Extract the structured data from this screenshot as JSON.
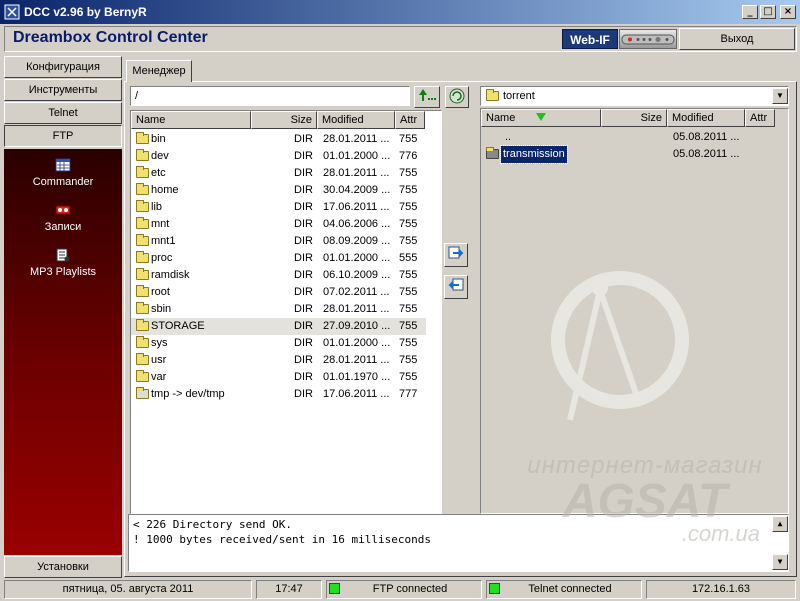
{
  "window": {
    "title": "DCC v2.96 by BernyR",
    "buttons": {
      "minimize": "_",
      "maximize": "□",
      "close": "×"
    }
  },
  "header": {
    "app_title": "Dreambox Control Center",
    "webif_label": "Web-IF",
    "exit_label": "Выход"
  },
  "sidebar": {
    "buttons": [
      "Конфигурация",
      "Инструменты",
      "Telnet",
      "FTP"
    ],
    "active": "FTP",
    "panel_items": [
      {
        "label": "Commander",
        "icon": "commander-icon"
      },
      {
        "label": "Записи",
        "icon": "recordings-icon"
      },
      {
        "label": "MP3 Playlists",
        "icon": "playlist-icon"
      }
    ],
    "settings_label": "Установки"
  },
  "tab": {
    "label": "Менеджер"
  },
  "left_panel": {
    "path": "/",
    "columns": [
      "Name",
      "Size",
      "Modified",
      "Attr"
    ],
    "rows": [
      {
        "name": "bin",
        "size": "DIR",
        "modified": "28.01.2011 ...",
        "attr": "755"
      },
      {
        "name": "dev",
        "size": "DIR",
        "modified": "01.01.2000 ...",
        "attr": "776"
      },
      {
        "name": "etc",
        "size": "DIR",
        "modified": "28.01.2011 ...",
        "attr": "755"
      },
      {
        "name": "home",
        "size": "DIR",
        "modified": "30.04.2009 ...",
        "attr": "755"
      },
      {
        "name": "lib",
        "size": "DIR",
        "modified": "17.06.2011 ...",
        "attr": "755"
      },
      {
        "name": "mnt",
        "size": "DIR",
        "modified": "04.06.2006 ...",
        "attr": "755"
      },
      {
        "name": "mnt1",
        "size": "DIR",
        "modified": "08.09.2009 ...",
        "attr": "755"
      },
      {
        "name": "proc",
        "size": "DIR",
        "modified": "01.01.2000 ...",
        "attr": "555"
      },
      {
        "name": "ramdisk",
        "size": "DIR",
        "modified": "06.10.2009 ...",
        "attr": "755"
      },
      {
        "name": "root",
        "size": "DIR",
        "modified": "07.02.2011 ...",
        "attr": "755"
      },
      {
        "name": "sbin",
        "size": "DIR",
        "modified": "28.01.2011 ...",
        "attr": "755"
      },
      {
        "name": "STORAGE",
        "size": "DIR",
        "modified": "27.09.2010 ...",
        "attr": "755"
      },
      {
        "name": "sys",
        "size": "DIR",
        "modified": "01.01.2000 ...",
        "attr": "755"
      },
      {
        "name": "usr",
        "size": "DIR",
        "modified": "28.01.2011 ...",
        "attr": "755"
      },
      {
        "name": "var",
        "size": "DIR",
        "modified": "01.01.1970 ...",
        "attr": "755"
      },
      {
        "name": "tmp -> dev/tmp",
        "size": "DIR",
        "modified": "17.06.2011 ...",
        "attr": "777"
      }
    ],
    "selected_row": "STORAGE"
  },
  "right_panel": {
    "path": "torrent",
    "columns": [
      "Name",
      "Size",
      "Modified",
      "Attr"
    ],
    "rows": [
      {
        "name": "..",
        "size": "",
        "modified": "05.08.2011 ...",
        "attr": ""
      },
      {
        "name": "transmission",
        "size": "",
        "modified": "05.08.2011 ...",
        "attr": ""
      }
    ],
    "selected_row": "transmission"
  },
  "log": [
    "< 226 Directory send OK.",
    "! 1000 bytes received/sent in 16 milliseconds"
  ],
  "status": {
    "date": "пятница, 05. августа 2011",
    "time": "17:47",
    "ftp": "FTP connected",
    "telnet": "Telnet connected",
    "ip": "172.16.1.63"
  },
  "watermark": {
    "line1": "интернет-магазин",
    "line2": "AGSAT",
    "line3": ".com.ua"
  },
  "colors": {
    "title_gradient_start": "#0a246a",
    "sidebar_panel": "#6a0000",
    "status_led": "#20e020"
  }
}
